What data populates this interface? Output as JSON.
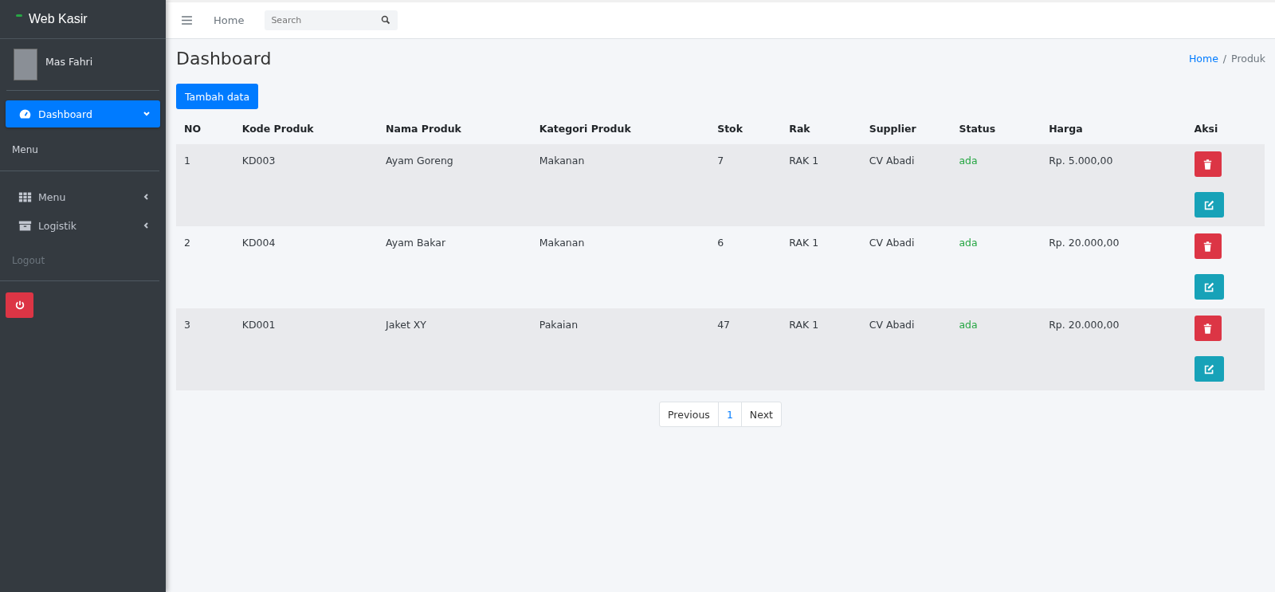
{
  "sidebar": {
    "brand": "Web Kasir",
    "user": "Mas Fahri",
    "nav": [
      {
        "label": "Dashboard",
        "kind": "gauge",
        "selected": true,
        "expanded": true
      }
    ],
    "section_label": "Menu",
    "items": [
      {
        "label": "Menu",
        "kind": "grid",
        "selected": false,
        "expanded": false
      },
      {
        "label": "Logistik",
        "kind": "archive",
        "selected": false,
        "expanded": false
      }
    ],
    "logout_label": "Logout"
  },
  "topbar": {
    "home": "Home",
    "search": {
      "placeholder": "Search"
    }
  },
  "page": {
    "title": "Dashboard",
    "breadcrumb": [
      {
        "label": "Home",
        "kind": "link"
      },
      {
        "label": "/",
        "kind": "separator"
      },
      {
        "label": "Produk",
        "kind": "current"
      }
    ],
    "add_button": "Tambah data"
  },
  "table": {
    "columns": [
      "NO",
      "Kode Produk",
      "Nama Produk",
      "Kategori Produk",
      "Stok",
      "Rak",
      "Supplier",
      "Status",
      "Harga",
      "Aksi"
    ],
    "rows": [
      {
        "no": "1",
        "kode": "KD003",
        "nama": "Ayam Goreng",
        "kategori": "Makanan",
        "stok": "7",
        "rak": "RAK 1",
        "supplier": "CV Abadi",
        "status": "ada",
        "harga": "Rp. 5.000,00"
      },
      {
        "no": "2",
        "kode": "KD004",
        "nama": "Ayam Bakar",
        "kategori": "Makanan",
        "stok": "6",
        "rak": "RAK 1",
        "supplier": "CV Abadi",
        "status": "ada",
        "harga": "Rp. 20.000,00"
      },
      {
        "no": "3",
        "kode": "KD001",
        "nama": "Jaket XY",
        "kategori": "Pakaian",
        "stok": "47",
        "rak": "RAK 1",
        "supplier": "CV Abadi",
        "status": "ada",
        "harga": "Rp. 20.000,00"
      }
    ]
  },
  "pagination": [
    {
      "label": "Previous",
      "selected": false
    },
    {
      "label": "1",
      "selected": true
    },
    {
      "label": "Next",
      "selected": false
    }
  ]
}
